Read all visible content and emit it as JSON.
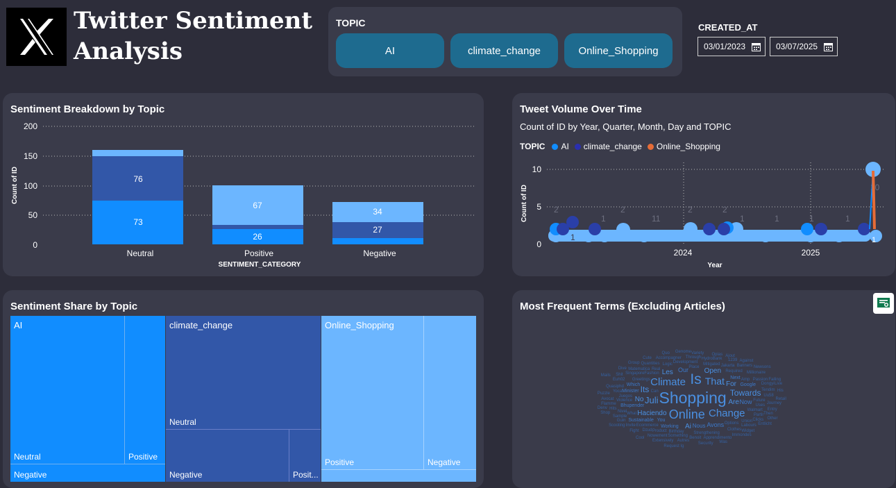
{
  "header": {
    "title_line1": "Twitter Sentiment",
    "title_line2": "Analysis",
    "logo": "x-logo-icon"
  },
  "topic_slicer": {
    "label": "TOPIC",
    "options": [
      "AI",
      "climate_change",
      "Online_Shopping"
    ]
  },
  "date_slicer": {
    "label": "CREATED_AT",
    "start": "03/01/2023",
    "end": "03/07/2025",
    "icon": "calendar-icon"
  },
  "colors": {
    "ai": "#118dff",
    "climate_change": "#3257a8",
    "online_shopping": "#6cb6ff",
    "orange": "#e66c37",
    "panel": "#3a3b4a",
    "background": "#2d2d3a"
  },
  "sentiment_breakdown": {
    "title": "Sentiment Breakdown by Topic",
    "ylabel": "Count of ID",
    "xlabel": "SENTIMENT_CATEGORY",
    "yticks": [
      "0",
      "50",
      "100",
      "150",
      "200"
    ]
  },
  "tweet_volume": {
    "title": "Tweet Volume Over Time",
    "subtitle": "Count of ID by Year, Quarter, Month, Day and TOPIC",
    "legend_title": "TOPIC",
    "legend": [
      "AI",
      "climate_change",
      "Online_Shopping"
    ],
    "ylabel": "Count of ID",
    "xlabel": "Year",
    "yticks": [
      "0",
      "5",
      "10"
    ],
    "xticks": [
      "2024",
      "2025"
    ]
  },
  "treemap": {
    "title": "Sentiment Share by Topic",
    "cells": {
      "ai": "AI",
      "ai_neutral": "Neutral",
      "ai_positive": "Positive",
      "ai_negative": "Negative",
      "cc": "climate_change",
      "cc_neutral": "Neutral",
      "cc_negative": "Negative",
      "cc_positive": "Posit...",
      "os": "Online_Shopping",
      "os_positive": "Positive",
      "os_negative": "Negative"
    }
  },
  "word_cloud": {
    "title": "Most Frequent Terms (Excluding Articles)",
    "icon": "report-icon",
    "words": [
      {
        "t": "Shopping",
        "s": 20
      },
      {
        "t": "Online",
        "s": 16
      },
      {
        "t": "Is",
        "s": 18
      },
      {
        "t": "Climate",
        "s": 13
      },
      {
        "t": "That",
        "s": 12
      },
      {
        "t": "Change",
        "s": 13
      },
      {
        "t": "Juli",
        "s": 11
      },
      {
        "t": "Towards",
        "s": 10
      },
      {
        "t": "Haciendo",
        "s": 9
      },
      {
        "t": "Its",
        "s": 10
      },
      {
        "t": "Are",
        "s": 9
      },
      {
        "t": "For",
        "s": 9
      },
      {
        "t": "Les",
        "s": 9
      },
      {
        "t": "No",
        "s": 9
      },
      {
        "t": "Open",
        "s": 9
      },
      {
        "t": "Avons",
        "s": 8
      },
      {
        "t": "Our",
        "s": 8
      },
      {
        "t": "Ai",
        "s": 9
      },
      {
        "t": "Now",
        "s": 8
      },
      {
        "t": "Nous",
        "s": 7
      },
      {
        "t": "Next",
        "s": 6
      },
      {
        "t": "Working",
        "s": 6
      },
      {
        "t": "You",
        "s": 6
      },
      {
        "t": "Which",
        "s": 6
      },
      {
        "t": "Google",
        "s": 6
      },
      {
        "t": "Minister",
        "s": 6
      },
      {
        "t": "Bhupender",
        "s": 6
      },
      {
        "t": "Sustainable",
        "s": 6
      },
      {
        "t": "Greetings",
        "s": 5
      },
      {
        "t": "Fashion",
        "s": 5
      },
      {
        "t": "Development",
        "s": 5
      },
      {
        "t": "Strengthening",
        "s": 5
      },
      {
        "t": "Options",
        "s": 5
      },
      {
        "t": "Mitigated",
        "s": 5
      },
      {
        "t": "Walmart",
        "s": 5
      },
      {
        "t": "Violence",
        "s": 5
      },
      {
        "t": "Required",
        "s": 5
      },
      {
        "t": "Birthday",
        "s": 5
      },
      {
        "t": "Union",
        "s": 5
      },
      {
        "t": "Place",
        "s": 5
      },
      {
        "t": "Amp",
        "s": 5
      },
      {
        "t": "Can",
        "s": 5
      },
      {
        "t": "Real",
        "s": 5
      },
      {
        "t": "Ecommerce",
        "s": 5
      },
      {
        "t": "Future",
        "s": 5
      },
      {
        "t": "Jakarta",
        "s": 5
      },
      {
        "t": "What",
        "s": 5
      },
      {
        "t": "Logic",
        "s": 5
      },
      {
        "t": "Juegos",
        "s": 5
      },
      {
        "t": "Product",
        "s": 5
      },
      {
        "t": "Uses",
        "s": 5
      },
      {
        "t": "Partir",
        "s": 5
      },
      {
        "t": "Something",
        "s": 5
      },
      {
        "t": "Clothes",
        "s": 5
      },
      {
        "t": "Through",
        "s": 5
      },
      {
        "t": "HydroBank",
        "s": 5
      },
      {
        "t": "Singapore",
        "s": 5
      },
      {
        "t": "Passion",
        "s": 5
      },
      {
        "t": "Benoit",
        "s": 5
      },
      {
        "t": "Millionaire",
        "s": 5
      },
      {
        "t": "Quantities",
        "s": 5
      },
      {
        "t": "Apprendimento",
        "s": 5
      },
      {
        "t": "Matematica",
        "s": 5
      },
      {
        "t": "Nivel",
        "s": 5
      },
      {
        "t": "Quasiphd",
        "s": 5
      },
      {
        "t": "Tendim",
        "s": 5
      },
      {
        "t": "Labours",
        "s": 5
      },
      {
        "t": "Uu58",
        "s": 5
      },
      {
        "t": "Accompagner",
        "s": 5
      },
      {
        "t": "Dzud",
        "s": 5
      },
      {
        "t": "Dongyi",
        "s": 5
      },
      {
        "t": "Nowement",
        "s": 5
      },
      {
        "t": "Yoca",
        "s": 5
      },
      {
        "t": "Euh02",
        "s": 5
      },
      {
        "t": "1239",
        "s": 5
      },
      {
        "t": "Clicks",
        "s": 5
      },
      {
        "t": "Journey",
        "s": 5
      },
      {
        "t": "Then",
        "s": 5
      },
      {
        "t": "Autres",
        "s": 5
      },
      {
        "t": "Banners",
        "s": 5
      },
      {
        "t": "Hits",
        "s": 5
      },
      {
        "t": "Invite",
        "s": 5
      },
      {
        "t": "Sample",
        "s": 5
      },
      {
        "t": "Widget",
        "s": 5
      },
      {
        "t": "Genome",
        "s": 5
      },
      {
        "t": "Avocat",
        "s": 5
      },
      {
        "t": "Flamme",
        "s": 5
      },
      {
        "t": "Opias",
        "s": 5
      },
      {
        "t": "Security",
        "s": 5
      },
      {
        "t": "Immondes",
        "s": 5
      },
      {
        "t": "Extensively",
        "s": 5
      },
      {
        "t": "Scooting",
        "s": 5
      },
      {
        "t": "Cute",
        "s": 5
      },
      {
        "t": "Fight",
        "s": 5
      },
      {
        "t": "Against",
        "s": 5
      },
      {
        "t": "Retail",
        "s": 5
      },
      {
        "t": "Entry",
        "s": 5
      },
      {
        "t": "Shit",
        "s": 5
      },
      {
        "t": "Puzzle",
        "s": 5
      },
      {
        "t": "Newsons",
        "s": 5
      },
      {
        "t": "Variety",
        "s": 5
      },
      {
        "t": "Group",
        "s": 5
      },
      {
        "t": "Live",
        "s": 5
      },
      {
        "t": "Failing",
        "s": 5
      },
      {
        "t": "His",
        "s": 5
      },
      {
        "t": "Other",
        "s": 5
      },
      {
        "t": "Request Ig",
        "s": 5
      },
      {
        "t": "Entlicht",
        "s": 5
      },
      {
        "t": "Guin",
        "s": 5
      },
      {
        "t": "Cool",
        "s": 5
      },
      {
        "t": "Dive",
        "s": 5
      },
      {
        "t": "Quo",
        "s": 5
      },
      {
        "t": "Denv",
        "s": 5
      },
      {
        "t": "Shop",
        "s": 5
      },
      {
        "t": "Ajout",
        "s": 5
      },
      {
        "t": "Was",
        "s": 5
      },
      {
        "t": "Mails",
        "s": 5
      }
    ]
  }
}
